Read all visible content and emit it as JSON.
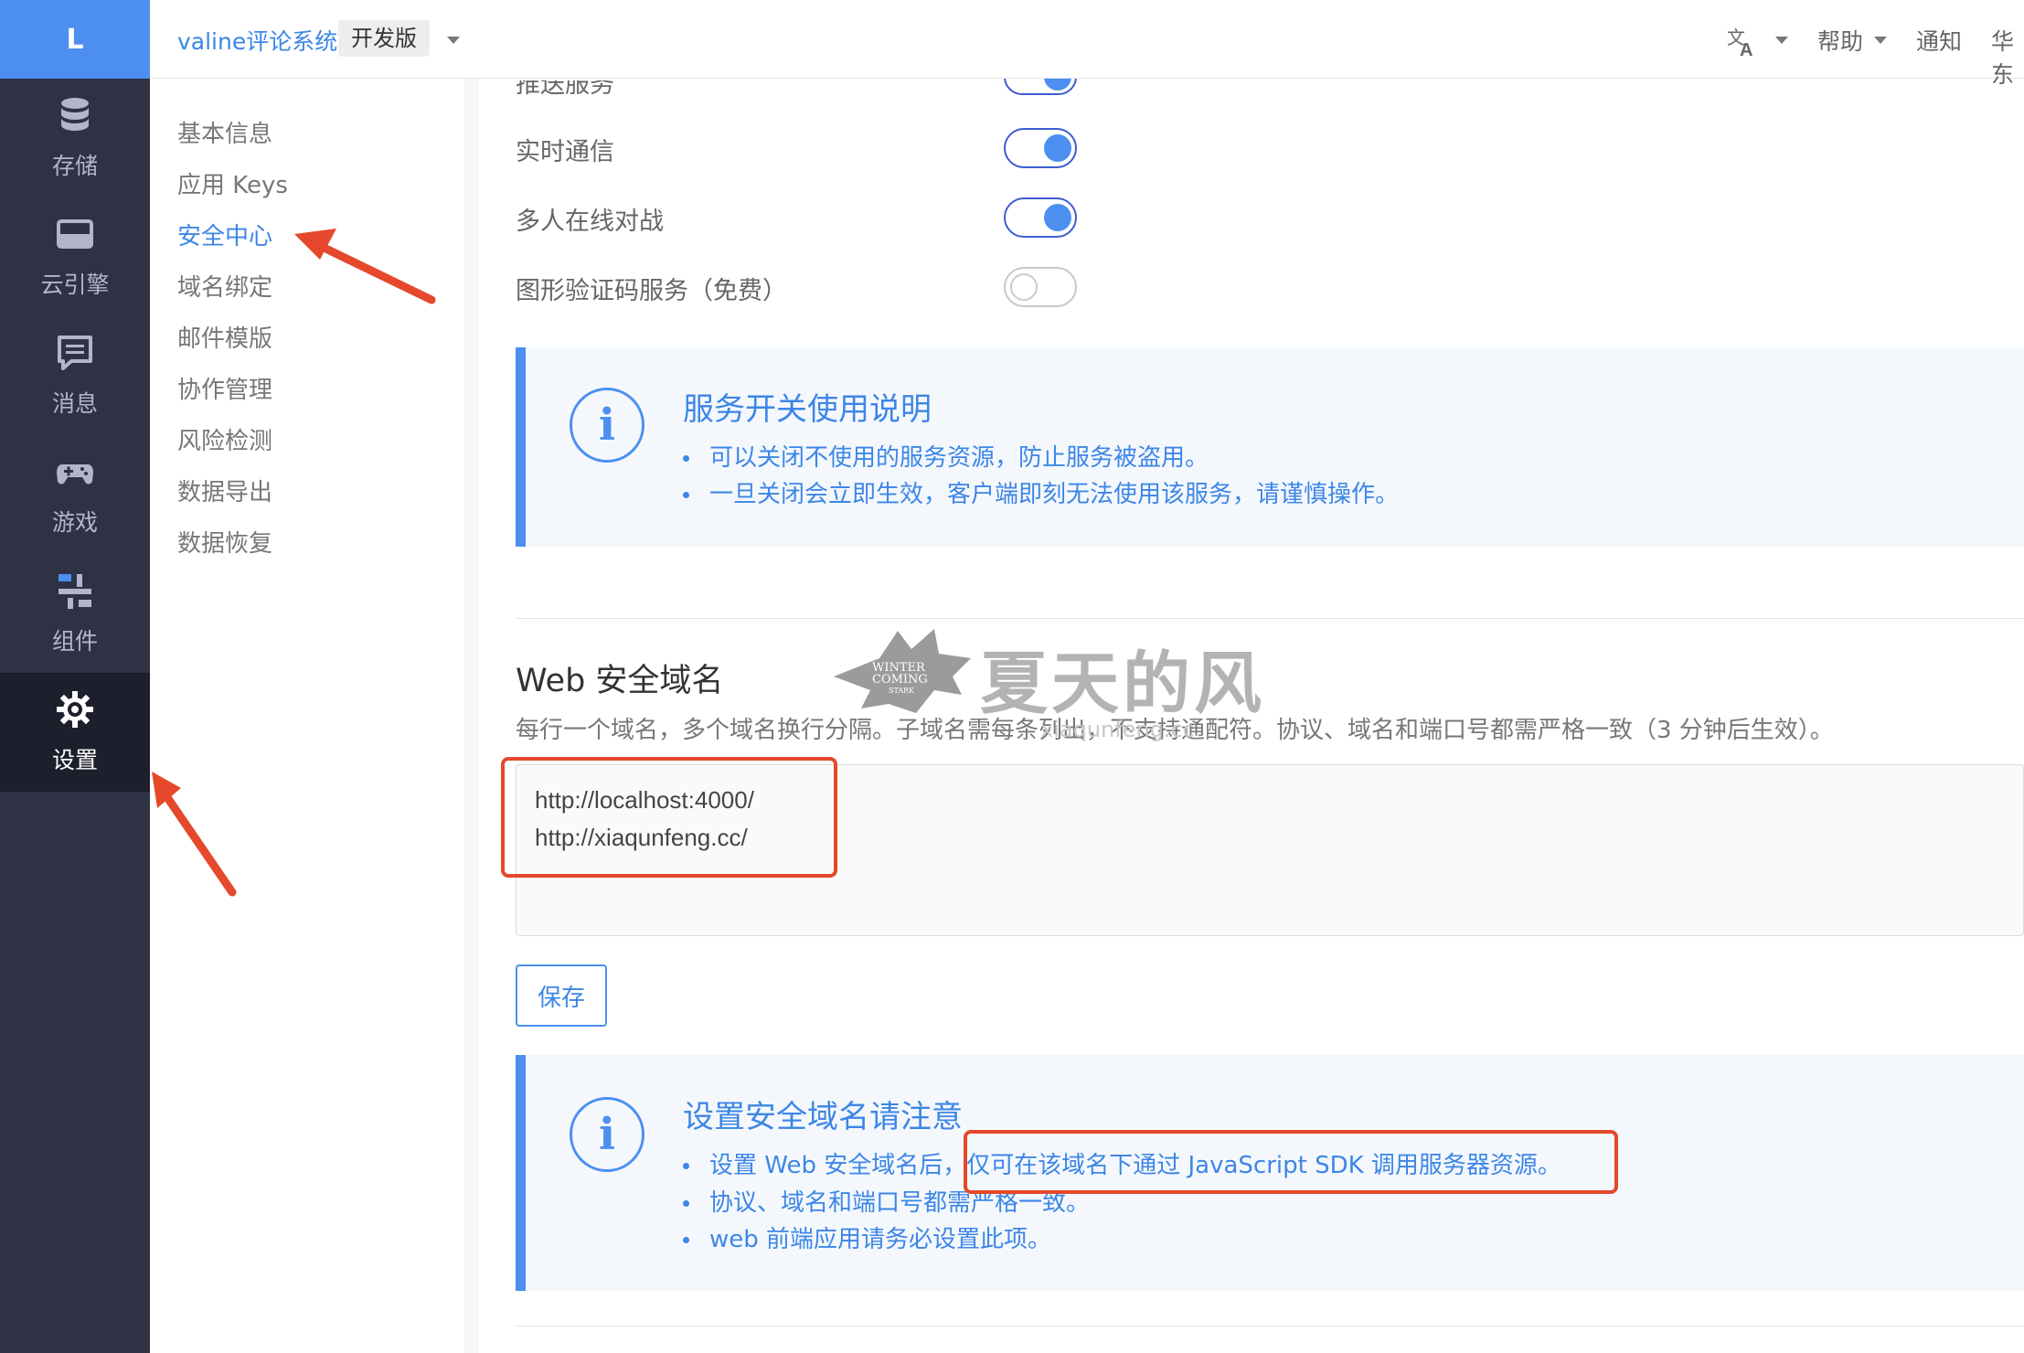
{
  "nav": {
    "logo": "L",
    "items": [
      {
        "label": "存储",
        "icon": "database-icon"
      },
      {
        "label": "云引擎",
        "icon": "server-icon"
      },
      {
        "label": "消息",
        "icon": "message-icon"
      },
      {
        "label": "游戏",
        "icon": "gamepad-icon"
      },
      {
        "label": "组件",
        "icon": "components-icon"
      },
      {
        "label": "设置",
        "icon": "gear-icon",
        "active": true
      }
    ]
  },
  "topbar": {
    "app_name": "valine评论系统",
    "plan": "开发版",
    "help": "帮助",
    "notify": "通知",
    "region": "华东",
    "language_icon": "translate-icon"
  },
  "submenu": {
    "items": [
      "基本信息",
      "应用 Keys",
      "安全中心",
      "域名绑定",
      "邮件模版",
      "协作管理",
      "风险检测",
      "数据导出",
      "数据恢复"
    ],
    "active": "安全中心"
  },
  "services": [
    {
      "label": "推送服务",
      "enabled": true
    },
    {
      "label": "实时通信",
      "enabled": true
    },
    {
      "label": "多人在线对战",
      "enabled": true
    },
    {
      "label": "图形验证码服务（免费）",
      "enabled": false
    }
  ],
  "service_notice": {
    "title": "服务开关使用说明",
    "items": [
      "可以关闭不使用的服务资源，防止服务被盗用。",
      "一旦关闭会立即生效，客户端即刻无法使用该服务，请谨慎操作。"
    ]
  },
  "web_domain": {
    "title": "Web 安全域名",
    "description": "每行一个域名，多个域名换行分隔。子域名需每条列出，不支持通配符。协议、域名和端口号都需严格一致（3 分钟后生效）。",
    "domains": "http://localhost:4000/\nhttp://xiaqunfeng.cc/",
    "save_label": "保存"
  },
  "domain_notice": {
    "title": "设置安全域名请注意",
    "items": [
      {
        "prefix": "设置 Web 安全域名后，",
        "highlight": "仅可在该域名下通过 JavaScript SDK 调用服务器资源。"
      },
      {
        "prefix": "协议、域名和端口号都需严格一致。",
        "highlight": ""
      },
      {
        "prefix": "web 前端应用请务必设置此项。",
        "highlight": ""
      }
    ]
  },
  "watermark": {
    "logo_lines": [
      "WINTER",
      "COMING",
      "STARK"
    ],
    "text": "夏天的风",
    "sub": "xiaqunfeng.cc"
  },
  "colors": {
    "accent": "#4c8ff0",
    "nav_bg": "#2f3145",
    "highlight": "#e5482b"
  }
}
